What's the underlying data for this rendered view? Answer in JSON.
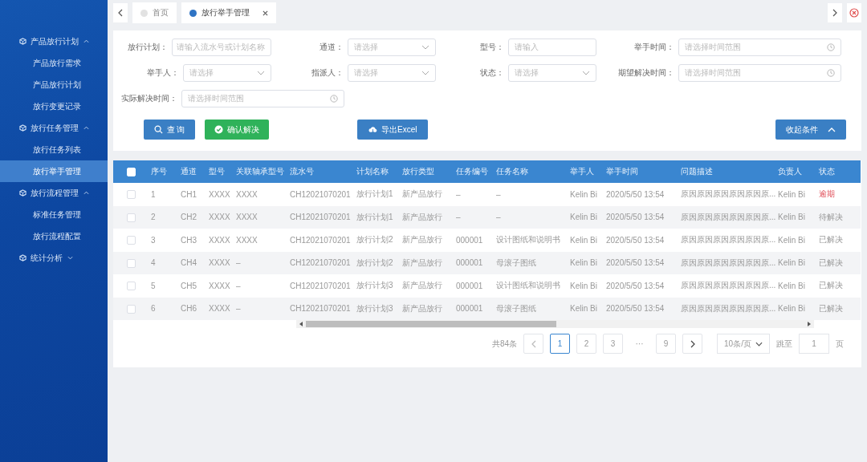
{
  "sidebar": {
    "groups": [
      {
        "label": "产品放行计划",
        "expanded": true,
        "children": [
          {
            "label": "产品放行需求",
            "selected": false
          },
          {
            "label": "产品放行计划",
            "selected": false
          },
          {
            "label": "放行变更记录",
            "selected": false
          }
        ]
      },
      {
        "label": "放行任务管理",
        "expanded": true,
        "children": [
          {
            "label": "放行任务列表",
            "selected": false
          },
          {
            "label": "放行举手管理",
            "selected": true
          }
        ]
      },
      {
        "label": "放行流程管理",
        "expanded": true,
        "children": [
          {
            "label": "标准任务管理",
            "selected": false
          },
          {
            "label": "放行流程配置",
            "selected": false
          }
        ]
      },
      {
        "label": "统计分析",
        "expanded": false
      }
    ]
  },
  "tabs": [
    {
      "label": "首页",
      "selected": false,
      "closable": false
    },
    {
      "label": "放行举手管理",
      "selected": true,
      "closable": true
    }
  ],
  "filters": [
    {
      "label": "放行计划：",
      "kind": "input",
      "placeholder": "请输入流水号或计划名称"
    },
    {
      "label": "通道：",
      "kind": "select",
      "placeholder": "请选择"
    },
    {
      "label": "型号：",
      "kind": "input",
      "placeholder": "请输入"
    },
    {
      "label": "举手时间：",
      "kind": "date",
      "placeholder": "请选择时间范围"
    },
    {
      "label": "举手人：",
      "kind": "select",
      "placeholder": "请选择"
    },
    {
      "label": "指派人：",
      "kind": "select",
      "placeholder": "请选择"
    },
    {
      "label": "状态：",
      "kind": "select",
      "placeholder": "请选择"
    },
    {
      "label": "期望解决时间：",
      "kind": "date",
      "placeholder": "请选择时间范围"
    },
    {
      "label": "实际解决时间：",
      "kind": "date",
      "placeholder": "请选择时间范围"
    }
  ],
  "buttons": [
    {
      "label": "查 询",
      "kind": "search"
    },
    {
      "label": "确认解决",
      "kind": "confirm"
    },
    {
      "label": "导出Excel",
      "kind": "export"
    },
    {
      "label": "收起条件",
      "kind": "collapse"
    }
  ],
  "table": {
    "header_checked": false,
    "columns": [
      "序号",
      "通道",
      "型号",
      "关联轴承型号",
      "流水号",
      "计划名称",
      "放行类型",
      "任务编号",
      "任务名称",
      "举手人",
      "举手时间",
      "问题描述",
      "负责人",
      "状态"
    ],
    "rows": [
      {
        "checked": false,
        "cells": [
          "1",
          "CH1",
          "XXXX",
          "XXXX",
          "CH12021070201",
          "放行计划1",
          "新产品放行",
          "–",
          "–",
          "Kelin Bi",
          "2020/5/50 13:54",
          "原因原因原因原因原因原...",
          "Kelin Bi"
        ],
        "status": "逾期",
        "overdue": true
      },
      {
        "checked": false,
        "cells": [
          "2",
          "CH2",
          "XXXX",
          "XXXX",
          "CH12021070201",
          "放行计划1",
          "新产品放行",
          "–",
          "–",
          "Kelin Bi",
          "2020/5/50 13:54",
          "原因原因原因原因原因原...",
          "Kelin Bi"
        ],
        "status": "待解决",
        "overdue": false
      },
      {
        "checked": false,
        "cells": [
          "3",
          "CH3",
          "XXXX",
          "XXXX",
          "CH12021070201",
          "放行计划2",
          "新产品放行",
          "000001",
          "设计图纸和说明书",
          "Kelin Bi",
          "2020/5/50 13:54",
          "原因原因原因原因原因原...",
          "Kelin Bi"
        ],
        "status": "已解决",
        "overdue": false
      },
      {
        "checked": false,
        "cells": [
          "4",
          "CH4",
          "XXXX",
          "–",
          "CH12021070201",
          "放行计划2",
          "新产品放行",
          "000001",
          "母滚子图纸",
          "Kelin Bi",
          "2020/5/50 13:54",
          "原因原因原因原因原因原...",
          "Kelin Bi"
        ],
        "status": "已解决",
        "overdue": false
      },
      {
        "checked": false,
        "cells": [
          "5",
          "CH5",
          "XXXX",
          "–",
          "CH12021070201",
          "放行计划3",
          "新产品放行",
          "000001",
          "设计图纸和说明书",
          "Kelin Bi",
          "2020/5/50 13:54",
          "原因原因原因原因原因原...",
          "Kelin Bi"
        ],
        "status": "已解决",
        "overdue": false
      },
      {
        "checked": false,
        "cells": [
          "6",
          "CH6",
          "XXXX",
          "–",
          "CH12021070201",
          "放行计划3",
          "新产品放行",
          "000001",
          "母滚子图纸",
          "Kelin Bi",
          "2020/5/50 13:54",
          "原因原因原因原因原因原...",
          "Kelin Bi"
        ],
        "status": "已解决",
        "overdue": false
      }
    ]
  },
  "pagination": {
    "total": "共84条",
    "pages": [
      {
        "label": "1",
        "selected": true
      },
      {
        "label": "2",
        "selected": false
      },
      {
        "label": "3",
        "selected": false
      },
      {
        "label": "···",
        "selected": false
      },
      {
        "label": "9",
        "selected": false
      }
    ],
    "page_size": "10条/页",
    "goto_label": "跳至",
    "goto_value": "1",
    "goto_suffix": "页"
  }
}
